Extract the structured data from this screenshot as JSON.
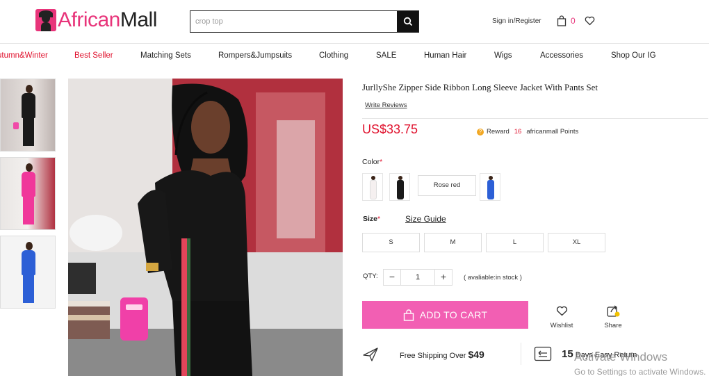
{
  "header": {
    "logo_prefix": "African",
    "logo_suffix": "Mall",
    "search_value": "crop top",
    "signin_label": "Sign in/Register",
    "cart_count": "0"
  },
  "nav": [
    {
      "label": "utumn&Winter",
      "red": true
    },
    {
      "label": "Best Seller",
      "red": true
    },
    {
      "label": "Matching Sets",
      "red": false
    },
    {
      "label": "Rompers&Jumpsuits",
      "red": false
    },
    {
      "label": "Clothing",
      "red": false
    },
    {
      "label": "SALE",
      "red": false
    },
    {
      "label": "Human Hair",
      "red": false
    },
    {
      "label": "Wigs",
      "red": false
    },
    {
      "label": "Accessories",
      "red": false
    },
    {
      "label": "Shop Our IG",
      "red": false
    }
  ],
  "product": {
    "title": "JurllyShe Zipper Side Ribbon Long Sleeve Jacket With Pants Set",
    "write_reviews": "Write Reviews",
    "price": "US$33.75",
    "reward_label": "Reward",
    "reward_points": "16",
    "reward_suffix": "africanmall Points",
    "color_label": "Color",
    "required_mark": "*",
    "color_options": [
      "white",
      "black",
      "Rose red",
      "blue"
    ],
    "size_label": "Size",
    "size_guide": "Size Guide",
    "sizes": [
      "S",
      "M",
      "L",
      "XL"
    ],
    "qty_label": "QTY:",
    "qty_minus": "−",
    "qty_value": "1",
    "qty_plus": "+",
    "stock_text": "( avaliable:in stock )",
    "add_to_cart": "ADD TO CART",
    "wishlist_label": "Wishlist",
    "share_label": "Share",
    "shipping_text": "Free Shipping Over",
    "shipping_amount": "$49",
    "return_days": "15",
    "return_text": "Days Easy Return"
  },
  "overlay": {
    "line1": "Activate Windows",
    "line2": "Go to Settings to activate Windows."
  },
  "colors": {
    "brand_pink": "#e8347a",
    "price_red": "#e0122e",
    "cart_button": "#f25fb3"
  }
}
